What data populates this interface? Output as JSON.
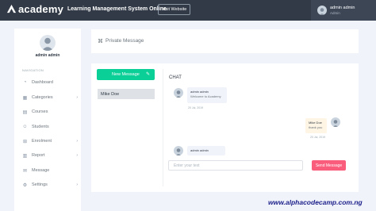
{
  "topbar": {
    "logo_text": "academy",
    "system_title": "Learning Management System Online",
    "visit_label": "Visit Website",
    "user_name": "admin admin",
    "user_role": "Admin"
  },
  "sidebar": {
    "profile_name": "admin admin",
    "nav_heading": "NAVIGATION",
    "items": [
      {
        "label": "Dashboard",
        "icon": "dashboard-icon"
      },
      {
        "label": "Categories",
        "icon": "categories-icon"
      },
      {
        "label": "Courses",
        "icon": "courses-icon"
      },
      {
        "label": "Students",
        "icon": "students-icon"
      },
      {
        "label": "Enrolment",
        "icon": "enrolment-icon"
      },
      {
        "label": "Report",
        "icon": "report-icon"
      },
      {
        "label": "Message",
        "icon": "message-icon"
      },
      {
        "label": "Settings",
        "icon": "settings-icon"
      }
    ]
  },
  "header": {
    "title": "Private Message"
  },
  "messages_panel": {
    "new_message_label": "New Message",
    "contacts": [
      "Mike Doe"
    ]
  },
  "chat": {
    "label": "CHAT",
    "messages": [
      {
        "sender": "admin admin",
        "text": "Welcome to Academy",
        "time": "20 Jul, 2019"
      },
      {
        "sender": "Mike Doe",
        "text": "thank you",
        "time": "20 Jul, 2019"
      },
      {
        "sender": "admin admin",
        "text": "",
        "time": ""
      }
    ],
    "input_placeholder": "Enter your text",
    "send_label": "Send Message"
  },
  "watermark": "www.alphacodecamp.com.ng",
  "colors": {
    "topbar": "#313a46",
    "new_message": "#0acf97",
    "send": "#fa5c7c",
    "background": "#f1f3fa"
  }
}
